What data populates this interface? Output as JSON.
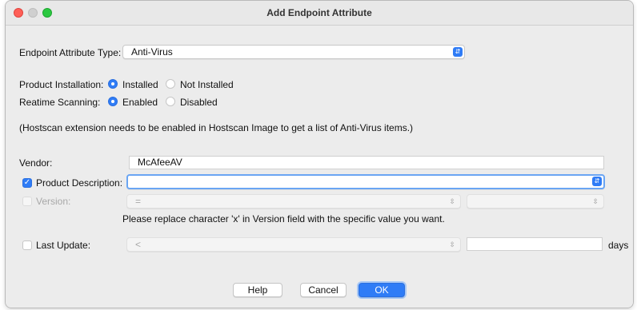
{
  "window": {
    "title": "Add Endpoint Attribute"
  },
  "type_row": {
    "label": "Endpoint Attribute Type:",
    "value": "Anti-Virus"
  },
  "install_row": {
    "label": "Product Installation:",
    "opt1": "Installed",
    "opt2": "Not Installed",
    "selected": "Installed"
  },
  "scan_row": {
    "label": "Reatime Scanning:",
    "opt1": "Enabled",
    "opt2": "Disabled",
    "selected": "Enabled"
  },
  "note": "(Hostscan extension needs to be enabled in Hostscan Image to get a list of Anti-Virus items.)",
  "vendor": {
    "label": "Vendor:",
    "value": "McAfeeAV"
  },
  "product_desc": {
    "label": "Product Description:",
    "value": "",
    "checked": true
  },
  "version": {
    "label": "Version:",
    "operator": "=",
    "value": "",
    "checked": false
  },
  "version_hint": "Please replace character 'x' in Version field with the specific value you want.",
  "last_update": {
    "label": "Last Update:",
    "operator": "<",
    "value": "",
    "unit": "days",
    "checked": false
  },
  "buttons": {
    "help": "Help",
    "cancel": "Cancel",
    "ok": "OK"
  },
  "colors": {
    "accent": "#2f7cf6",
    "close": "#fe5f57",
    "maximize": "#2bc840"
  },
  "icons": {
    "select_arrow": "chevron-updown-icon",
    "checkmark": "checkmark-icon"
  }
}
